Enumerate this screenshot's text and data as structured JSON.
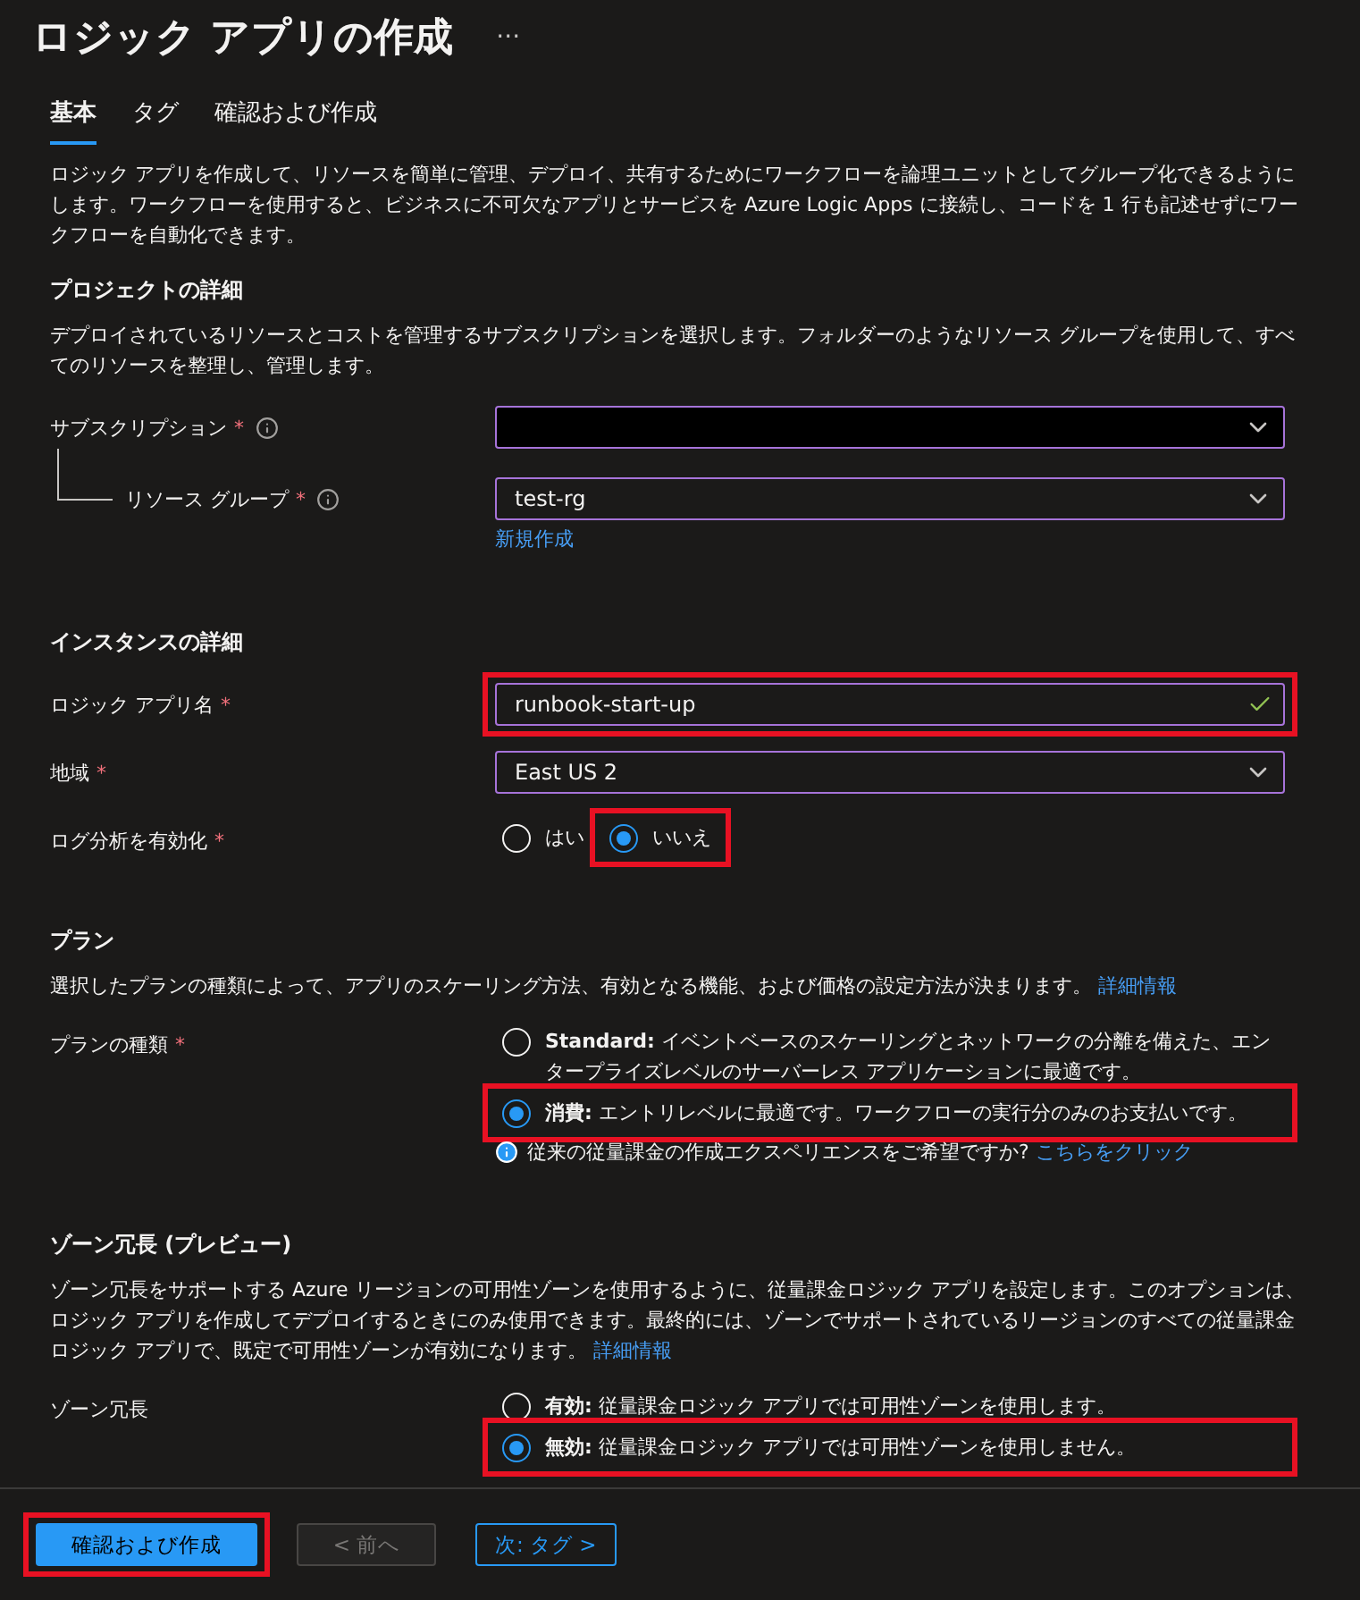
{
  "header": {
    "title": "ロジック アプリの作成",
    "more": "···"
  },
  "tabs": [
    {
      "label": "基本",
      "selected": true
    },
    {
      "label": "タグ",
      "selected": false
    },
    {
      "label": "確認および作成",
      "selected": false
    }
  ],
  "intro": "ロジック アプリを作成して、リソースを簡単に管理、デプロイ、共有するためにワークフローを論理ユニットとしてグループ化できるようにします。ワークフローを使用すると、ビジネスに不可欠なアプリとサービスを Azure Logic Apps に接続し、コードを 1 行も記述せずにワークフローを自動化できます。",
  "sections": [
    {
      "title": "プロジェクトの詳細",
      "description": "デプロイされているリソースとコストを管理するサブスクリプションを選択します。フォルダーのようなリソース グループを使用して、すべてのリソースを整理し、管理します。",
      "fields": [
        {
          "kind": "select",
          "label": "サブスクリプション",
          "required_mark": "*",
          "info": true,
          "redacted": true,
          "highlighted": false
        },
        {
          "kind": "select",
          "label": "リソース グループ",
          "required_mark": "*",
          "info": true,
          "indented": true,
          "value": "test-rg",
          "link": "新規作成",
          "highlighted": false
        }
      ]
    },
    {
      "title": "インスタンスの詳細",
      "fields": [
        {
          "kind": "text",
          "label": "ロジック アプリ名",
          "required_mark": "*",
          "value": "runbook-start-up",
          "valid": true,
          "highlighted": true
        },
        {
          "kind": "select",
          "label": "地域",
          "required_mark": "*",
          "value": "East US 2",
          "highlighted": false
        },
        {
          "kind": "radio-row",
          "label": "ログ分析を有効化",
          "required_mark": "*",
          "options": [
            {
              "label": "はい",
              "selected": false,
              "highlighted": false
            },
            {
              "label": "いいえ",
              "selected": true,
              "highlighted": true
            }
          ]
        }
      ]
    },
    {
      "title": "プラン",
      "description": "選択したプランの種類によって、アプリのスケーリング方法、有効となる機能、および価格の設定方法が決まります。",
      "description_link": "詳細情報",
      "fields": [
        {
          "kind": "radio-list",
          "label": "プランの種類",
          "required_mark": "*",
          "options": [
            {
              "label": "**Standard:** イベントベースのスケーリングとネットワークの分離を備えた、エンタープライズレベルのサーバーレス アプリケーションに最適です。",
              "selected": false,
              "highlighted": false
            },
            {
              "label": "**消費:** エントリレベルに最適です。ワークフローの実行分のみのお支払いです。",
              "selected": true,
              "highlighted": true
            }
          ],
          "note": {
            "text": "従来の従量課金の作成エクスペリエンスをご希望ですか?",
            "link": "こちらをクリック"
          }
        }
      ]
    },
    {
      "title": "ゾーン冗長 (プレビュー)",
      "description": "ゾーン冗長をサポートする Azure リージョンの可用性ゾーンを使用するように、従量課金ロジック アプリを設定します。このオプションは、ロジック アプリを作成してデプロイするときにのみ使用できます。最終的には、ゾーンでサポートされているリージョンのすべての従量課金ロジック アプリで、既定で可用性ゾーンが有効になります。",
      "description_link": "詳細情報",
      "fields": [
        {
          "kind": "radio-list",
          "label": "ゾーン冗長",
          "options": [
            {
              "label": "**有効:** 従量課金ロジック アプリでは可用性ゾーンを使用します。",
              "selected": false,
              "highlighted": false
            },
            {
              "label": "**無効:** 従量課金ロジック アプリでは可用性ゾーンを使用しません。",
              "selected": true,
              "highlighted": true
            }
          ]
        }
      ]
    }
  ],
  "footer": {
    "buttons": [
      {
        "label": "確認および作成",
        "kind": "primary",
        "disabled": false,
        "highlighted": true
      },
      {
        "label": "< 前へ",
        "kind": "outline",
        "disabled": true,
        "highlighted": false
      },
      {
        "label": "次: タグ >",
        "kind": "outline",
        "disabled": false,
        "highlighted": false
      }
    ]
  }
}
